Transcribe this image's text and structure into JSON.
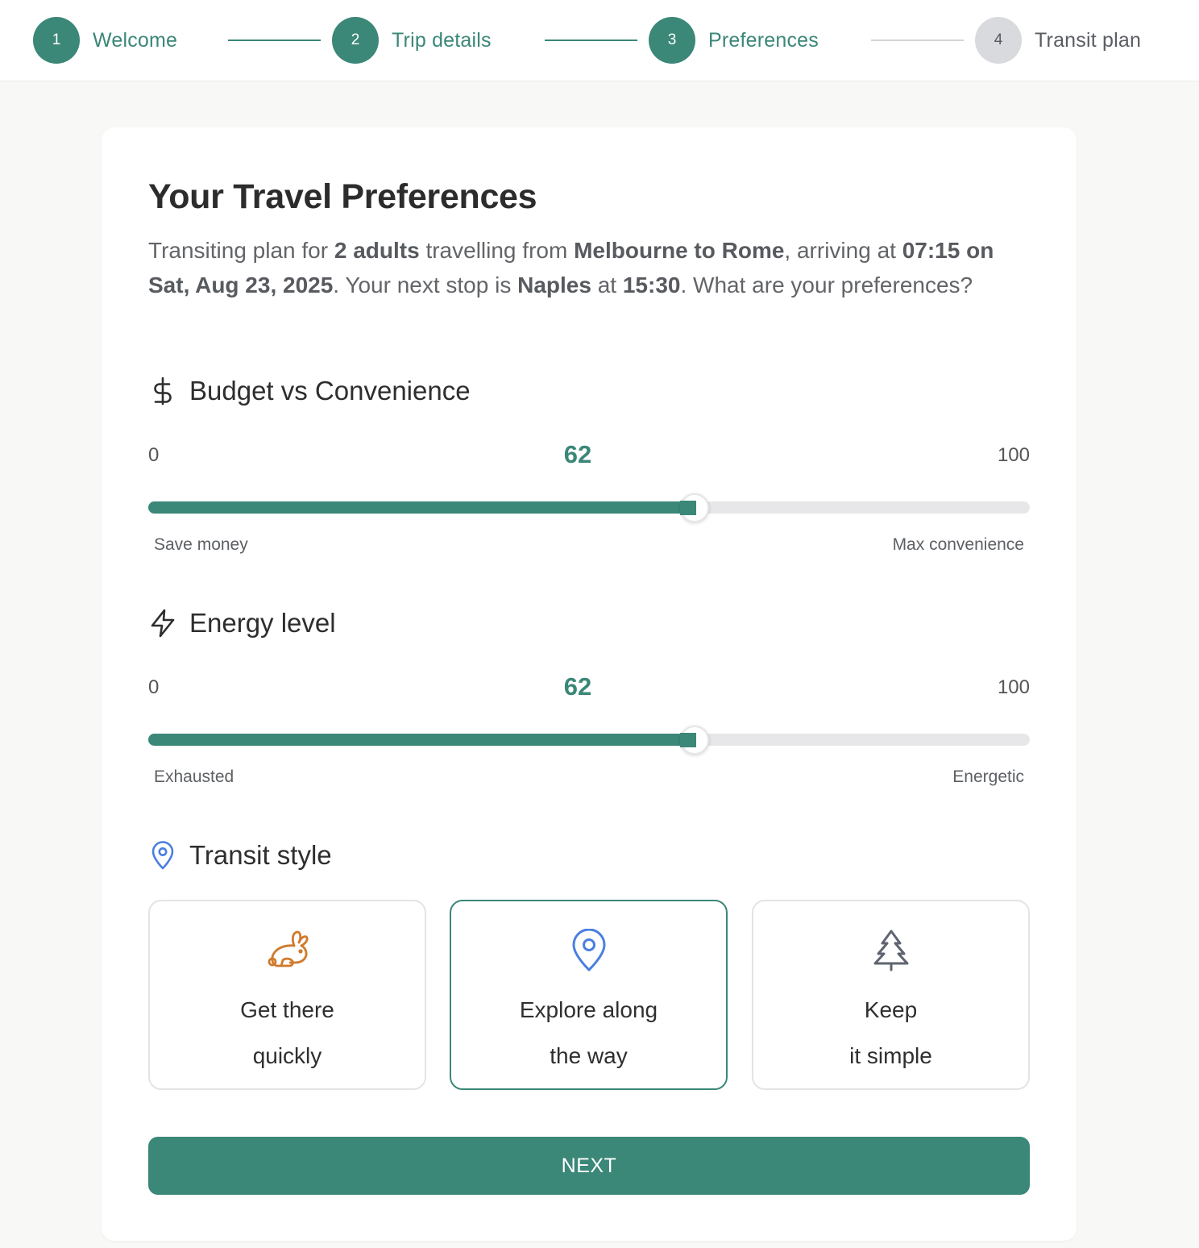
{
  "stepper": {
    "steps": [
      {
        "number": "1",
        "label": "Welcome",
        "state": "complete"
      },
      {
        "number": "2",
        "label": "Trip details",
        "state": "complete"
      },
      {
        "number": "3",
        "label": "Preferences",
        "state": "current"
      },
      {
        "number": "4",
        "label": "Transit plan",
        "state": "upcoming"
      }
    ]
  },
  "card": {
    "title": "Your Travel Preferences",
    "summary": {
      "t1": "Transiting plan for ",
      "adults": "2 adults",
      "t2": " travelling from ",
      "route": "Melbourne to Rome",
      "t3": ", arriving at ",
      "arrival": "07:15 on Sat, Aug 23, 2025",
      "t4": ". Your next stop is ",
      "next_stop": "Naples",
      "t5": " at ",
      "next_time": "15:30",
      "t6": ". What are your preferences?"
    }
  },
  "budget": {
    "icon": "dollar-icon",
    "heading": "Budget vs Convenience",
    "min": "0",
    "max": "100",
    "value": 62,
    "value_label": "62",
    "low_hint": "Save money",
    "high_hint": "Max convenience"
  },
  "energy": {
    "icon": "lightning-icon",
    "heading": "Energy level",
    "min": "0",
    "max": "100",
    "value": 62,
    "value_label": "62",
    "low_hint": "Exhausted",
    "high_hint": "Energetic"
  },
  "transit_style": {
    "icon": "map-pin-icon",
    "heading": "Transit style",
    "options": [
      {
        "line1": "Get there",
        "line2": "quickly",
        "icon": "rabbit-icon",
        "selected": false
      },
      {
        "line1": "Explore along",
        "line2": "the way",
        "icon": "map-pin-icon",
        "selected": true
      },
      {
        "line1": "Keep",
        "line2": "it simple",
        "icon": "tree-icon",
        "selected": false
      }
    ]
  },
  "actions": {
    "next_label": "NEXT"
  },
  "colors": {
    "accent": "#3b8778",
    "pin_blue": "#4a7fe0",
    "rabbit_orange": "#d07a2c",
    "tree_gray": "#5f6470"
  }
}
